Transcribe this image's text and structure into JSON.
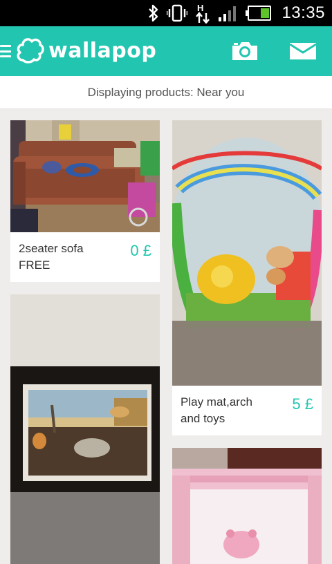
{
  "status_bar": {
    "time": "13:35",
    "icons": [
      "bluetooth-icon",
      "vibrate-icon",
      "hspa-data-icon",
      "signal-icon",
      "battery-icon"
    ]
  },
  "app_bar": {
    "brand": "wallapop",
    "actions": [
      "camera-icon",
      "mail-icon"
    ],
    "accent_color": "#22c6b0"
  },
  "subheader": {
    "text": "Displaying products: Near you"
  },
  "products": [
    {
      "title": "2seater sofa FREE",
      "price": "0 £"
    },
    {
      "title": "Play mat,arch and toys",
      "price": "5 £"
    },
    {
      "title": "",
      "price": ""
    },
    {
      "title": "",
      "price": ""
    }
  ]
}
